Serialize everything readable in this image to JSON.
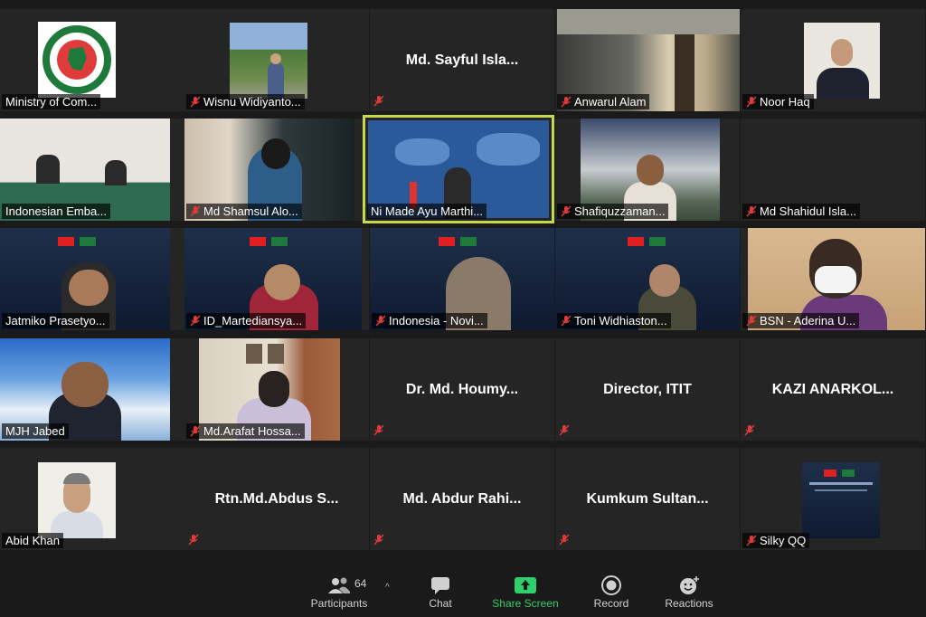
{
  "tiles": [
    {
      "name": "Ministry of Com...",
      "muted": false
    },
    {
      "name": "Wisnu Widiyanto...",
      "muted": true
    },
    {
      "name": "Md. Sayful Isla...",
      "muted": true,
      "center": true
    },
    {
      "name": "Anwarul Alam",
      "muted": true
    },
    {
      "name": "Noor Haq",
      "muted": true
    },
    {
      "name": "Indonesian Emba...",
      "muted": false
    },
    {
      "name": "Md Shamsul Alo...",
      "muted": true
    },
    {
      "name": "Ni Made Ayu Marthi...",
      "muted": false
    },
    {
      "name": "Shafiquzzaman...",
      "muted": true
    },
    {
      "name": "Md Shahidul Isla...",
      "muted": true
    },
    {
      "name": "Jatmiko Prasetyo...",
      "muted": false
    },
    {
      "name": "ID_Martediansya...",
      "muted": true
    },
    {
      "name": "Indonesia - Novi...",
      "muted": true
    },
    {
      "name": "Toni Widhiaston...",
      "muted": true
    },
    {
      "name": "BSN - Aderina U...",
      "muted": true
    },
    {
      "name": "MJH Jabed",
      "muted": false
    },
    {
      "name": "Md.Arafat Hossa...",
      "muted": true
    },
    {
      "name": "Dr. Md. Houmy...",
      "muted": true,
      "center": true
    },
    {
      "name": "Director, ITIT",
      "muted": true,
      "center": true
    },
    {
      "name": "KAZI ANARKOL...",
      "muted": true,
      "center": true
    },
    {
      "name": "Abid Khan",
      "muted": false
    },
    {
      "name": "Rtn.Md.Abdus S...",
      "muted": true,
      "center": true
    },
    {
      "name": "Md. Abdur Rahi...",
      "muted": true,
      "center": true
    },
    {
      "name": "Kumkum Sultan...",
      "muted": true,
      "center": true
    },
    {
      "name": "Silky QQ",
      "muted": true
    }
  ],
  "toolbar": {
    "participants_label": "Participants",
    "participants_count": "64",
    "chat_label": "Chat",
    "share_label": "Share Screen",
    "record_label": "Record",
    "reactions_label": "Reactions"
  },
  "colors": {
    "active_border": "#c5d94a",
    "share_green": "#2fd06b",
    "mute_red": "#e03b3b"
  }
}
